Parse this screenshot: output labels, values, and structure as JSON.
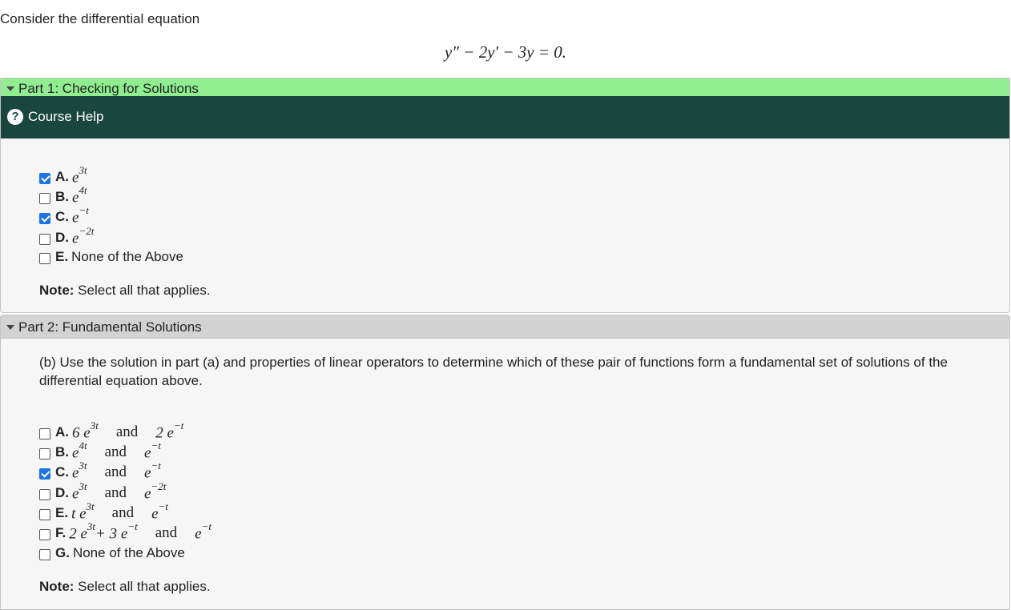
{
  "intro": "Consider the differential equation",
  "equation": {
    "a": "y″ − 2",
    "b": "y′ − 3",
    "c": "y = 0."
  },
  "part1": {
    "header": "Part 1: Checking for Solutions",
    "help": "Course Help",
    "options": [
      {
        "letter": "A.",
        "base": "e",
        "exp": "3t",
        "checked": true
      },
      {
        "letter": "B.",
        "base": "e",
        "exp": "4t",
        "checked": false
      },
      {
        "letter": "C.",
        "base": "e",
        "exp": "−t",
        "checked": true
      },
      {
        "letter": "D.",
        "base": "e",
        "exp": "−2t",
        "checked": false
      },
      {
        "letter": "E.",
        "text": "None of the Above",
        "checked": false
      }
    ],
    "note_label": "Note:",
    "note_text": " Select all that applies."
  },
  "part2": {
    "header": "Part 2: Fundamental Solutions",
    "question": "(b) Use the solution in part (a) and properties of linear operators to determine which of these pair of functions form a fundamental set of solutions of the differential equation above.",
    "options": [
      {
        "letter": "A.",
        "checked": false,
        "f1": "6 e",
        "f1exp": "3t",
        "and": "and",
        "f2": "2 e",
        "f2exp": "−t"
      },
      {
        "letter": "B.",
        "checked": false,
        "f1": "e",
        "f1exp": "4t",
        "and": "and",
        "f2": "e",
        "f2exp": "−t"
      },
      {
        "letter": "C.",
        "checked": true,
        "f1": "e",
        "f1exp": "3t",
        "and": "and",
        "f2": "e",
        "f2exp": "−t"
      },
      {
        "letter": "D.",
        "checked": false,
        "f1": "e",
        "f1exp": "3t",
        "and": "and",
        "f2": "e",
        "f2exp": "−2t"
      },
      {
        "letter": "E.",
        "checked": false,
        "f1": "t e",
        "f1exp": "3t",
        "and": "and",
        "f2": "e",
        "f2exp": "−t"
      },
      {
        "letter": "F.",
        "checked": false,
        "f1": "2 e",
        "f1exp": "3t",
        "f1b": " + 3 e",
        "f1bexp": "−t",
        "and": "and",
        "f2": "e",
        "f2exp": "−t"
      },
      {
        "letter": "G.",
        "checked": false,
        "text": "None of the Above"
      }
    ],
    "note_label": "Note:",
    "note_text": " Select all that applies."
  }
}
